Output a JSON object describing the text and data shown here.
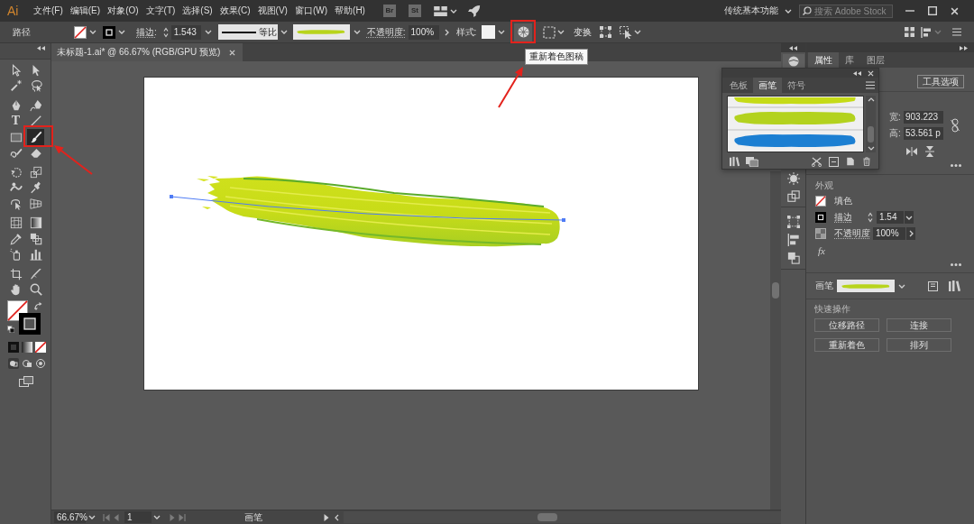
{
  "menu_bar": {
    "logo": "Ai",
    "items": [
      "文件(F)",
      "编辑(E)",
      "对象(O)",
      "文字(T)",
      "选择(S)",
      "效果(C)",
      "视图(V)",
      "窗口(W)",
      "帮助(H)"
    ],
    "app_buttons": [
      "Br",
      "St"
    ],
    "workspace": "传统基本功能",
    "search": {
      "placeholder": "搜索 Adobe Stock"
    }
  },
  "control_bar": {
    "selection": "路径",
    "stroke_label": "描边:",
    "stroke_weight": "1.543",
    "profile_label": "等比",
    "opacity_label": "不透明度:",
    "opacity_value": "100%",
    "style_label": "样式:",
    "recolor": {
      "highlighted": true,
      "tooltip": "重新着色图稿"
    },
    "transform_label": "变换"
  },
  "toolbar": {
    "tools": [
      {
        "selected": false,
        "highlighted": false
      },
      {
        "selected": false,
        "highlighted": false
      },
      {
        "selected": false,
        "highlighted": false
      },
      {
        "selected": false,
        "highlighted": false
      },
      {
        "selected": false,
        "highlighted": false
      },
      {
        "selected": false,
        "highlighted": false
      },
      {
        "selected": false,
        "highlighted": false,
        "glyph": "T"
      },
      {
        "selected": false,
        "highlighted": false
      },
      {
        "selected": false,
        "highlighted": false
      },
      {
        "selected": true,
        "highlighted": true
      },
      {
        "selected": false,
        "highlighted": false
      },
      {
        "selected": false,
        "highlighted": false
      },
      {
        "selected": false,
        "highlighted": false
      },
      {
        "selected": false,
        "highlighted": false
      },
      {
        "selected": false,
        "highlighted": false
      },
      {
        "selected": false,
        "highlighted": false
      },
      {
        "selected": false,
        "highlighted": false
      },
      {
        "selected": false,
        "highlighted": false
      },
      {
        "selected": false,
        "highlighted": false
      },
      {
        "selected": false,
        "highlighted": false
      },
      {
        "selected": false,
        "highlighted": false
      },
      {
        "selected": false,
        "highlighted": false
      },
      {
        "selected": false,
        "highlighted": false
      },
      {
        "selected": false,
        "highlighted": false
      },
      {
        "selected": false,
        "highlighted": false
      },
      {
        "selected": false,
        "highlighted": false
      },
      {
        "selected": false,
        "highlighted": false
      },
      {
        "selected": false,
        "highlighted": false
      }
    ]
  },
  "document": {
    "tab": "未标题-1.ai* @ 66.67% (RGB/GPU 预览)"
  },
  "status_bar": {
    "zoom": "66.67%",
    "artboard": "1",
    "current_tool": "画笔"
  },
  "brushes_panel": {
    "tabs": [
      {
        "label": "色板",
        "selected": false
      },
      {
        "label": "画笔",
        "selected": true
      },
      {
        "label": "符号",
        "selected": false
      }
    ],
    "brushes": [
      {
        "color": "#c5db17"
      },
      {
        "color": "#b3d21e"
      },
      {
        "color": "#1c7fd2"
      }
    ]
  },
  "properties_panel": {
    "tabs": [
      {
        "label": "属性",
        "selected": true
      },
      {
        "label": "库",
        "selected": false
      },
      {
        "label": "图层",
        "selected": false
      }
    ],
    "tool_options": "工具选项",
    "width": {
      "label": "宽:",
      "value": "903.223"
    },
    "height": {
      "label": "高:",
      "value": "53.561 p"
    },
    "appearance": {
      "title": "外观",
      "fill_label": "填色",
      "stroke_label": "描边",
      "stroke_weight": "1.54",
      "opacity_label": "不透明度",
      "opacity_value": "100%",
      "effects": "fx"
    },
    "brush_label": "画笔",
    "quick_actions": {
      "title": "快速操作",
      "buttons": [
        "位移路径",
        "连接",
        "重新着色",
        "排列"
      ]
    }
  }
}
